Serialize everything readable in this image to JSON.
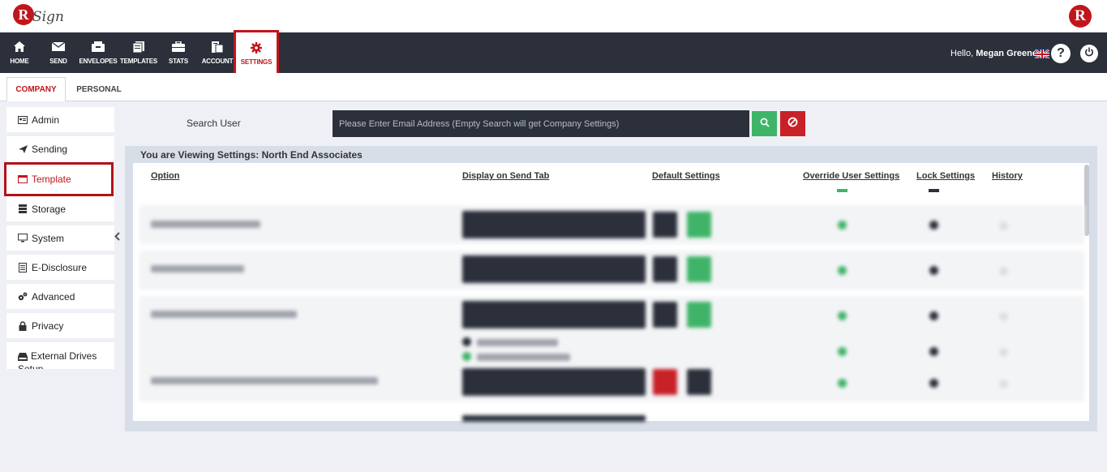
{
  "app": {
    "brand_right": "R",
    "logo_letter": "R",
    "logo_word": "Sign"
  },
  "nav": {
    "items": [
      {
        "label": "HOME",
        "icon": "home-icon"
      },
      {
        "label": "SEND",
        "icon": "envelope-icon"
      },
      {
        "label": "ENVELOPES",
        "icon": "inbox-icon"
      },
      {
        "label": "TEMPLATES",
        "icon": "templates-icon"
      },
      {
        "label": "STATS",
        "icon": "briefcase-icon"
      },
      {
        "label": "ACCOUNT",
        "icon": "account-icon"
      },
      {
        "label": "SETTINGS",
        "icon": "gear-icon"
      }
    ],
    "hello_prefix": "Hello,",
    "user_name": "Megan Greene",
    "help_label": "?"
  },
  "tabs": [
    {
      "label": "COMPANY"
    },
    {
      "label": "PERSONAL"
    }
  ],
  "sidebar": {
    "items": [
      {
        "label": "Admin",
        "icon": "id-card-icon"
      },
      {
        "label": "Sending",
        "icon": "paper-plane-icon"
      },
      {
        "label": "Template",
        "icon": "window-icon"
      },
      {
        "label": "Storage",
        "icon": "database-icon"
      },
      {
        "label": "System",
        "icon": "monitor-icon"
      },
      {
        "label": "E-Disclosure",
        "icon": "document-icon"
      },
      {
        "label": "Advanced",
        "icon": "cogs-icon"
      },
      {
        "label": "Privacy",
        "icon": "lock-icon"
      },
      {
        "label": "External Drives Setup",
        "icon": "hdd-icon"
      }
    ]
  },
  "search": {
    "label": "Search User",
    "placeholder": "Please Enter Email Address (Empty Search will get Company Settings)",
    "value": ""
  },
  "settings": {
    "viewing_title": "You are Viewing Settings: North End Associates",
    "columns": [
      "Option",
      "Display on Send Tab",
      "Default Settings",
      "Override User Settings",
      "Lock Settings",
      "History"
    ]
  },
  "colors": {
    "accent": "#c0161c",
    "navbar": "#2b303b",
    "success": "#3fb468",
    "danger": "#c82128"
  }
}
